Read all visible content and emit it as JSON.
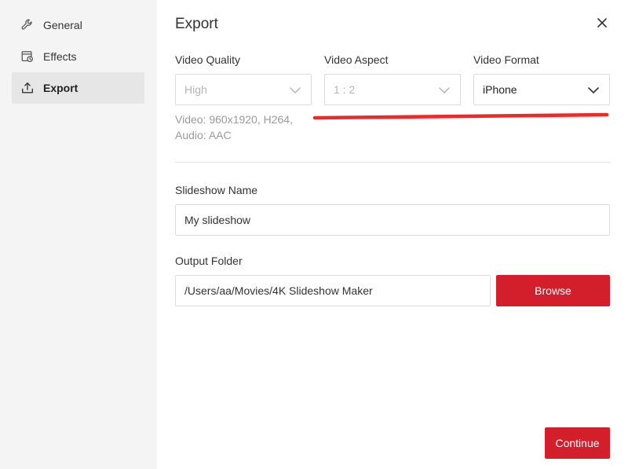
{
  "sidebar": {
    "items": [
      {
        "label": "General",
        "icon": "wrench-icon"
      },
      {
        "label": "Effects",
        "icon": "effects-icon"
      },
      {
        "label": "Export",
        "icon": "export-icon"
      }
    ],
    "active_item": "Export"
  },
  "header": {
    "title": "Export"
  },
  "video_quality": {
    "label": "Video Quality",
    "value": "High"
  },
  "video_aspect": {
    "label": "Video Aspect",
    "value": "1 : 2"
  },
  "video_format": {
    "label": "Video Format",
    "value": "iPhone"
  },
  "info": {
    "line1": "Video: 960x1920, H264,",
    "line2": "Audio: AAC"
  },
  "slideshow_name": {
    "label": "Slideshow Name",
    "value": "My slideshow"
  },
  "output_folder": {
    "label": "Output Folder",
    "value": "/Users/aa/Movies/4K Slideshow Maker",
    "browse_label": "Browse"
  },
  "footer": {
    "continue_label": "Continue"
  },
  "colors": {
    "accent": "#d21f2b",
    "sidebar_bg": "#f4f4f4",
    "annotation": "#f0282a"
  }
}
